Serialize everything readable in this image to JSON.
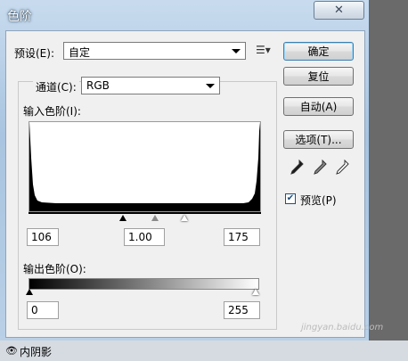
{
  "window": {
    "title": "色阶",
    "close": "✕"
  },
  "preset": {
    "label": "预设(E):",
    "value": "自定",
    "menu_icon": "menu-list-icon"
  },
  "channel": {
    "label": "通道(C):",
    "value": "RGB"
  },
  "input": {
    "label": "输入色阶(I):",
    "black": "106",
    "gamma": "1.00",
    "white": "175"
  },
  "output": {
    "label": "输出色阶(O):",
    "black": "0",
    "white": "255"
  },
  "buttons": {
    "ok": "确定",
    "reset": "复位",
    "auto": "自动(A)",
    "options": "选项(T)..."
  },
  "preview": {
    "label": "预览(P)",
    "checked": true
  },
  "background": {
    "layer_label": "内阴影"
  },
  "watermark": "jingyan.baidu.com",
  "colors": {
    "title_text": "#ffffff",
    "accent": "#3c7fb1",
    "check": "#1f4d7a"
  }
}
